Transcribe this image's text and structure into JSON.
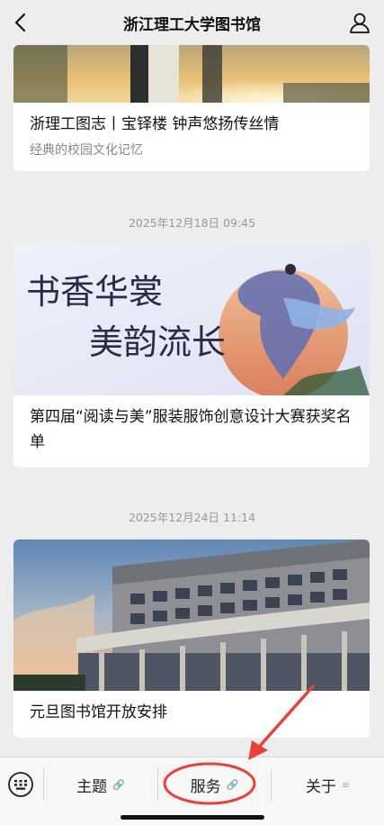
{
  "header": {
    "title": "浙江理工大学图书馆",
    "back_icon": "back-chevron-icon",
    "profile_icon": "user-icon"
  },
  "feed": {
    "card1": {
      "title": "浙理工图志丨宝铎楼 钟声悠扬传丝情",
      "subtitle": "经典的校园文化记忆"
    },
    "timestamp1": "2025年12月18日 09:45",
    "card2": {
      "banner_line1": "书香华裳",
      "banner_line2": "美韵流长",
      "title": "第四届“阅读与美”服装服饰创意设计大赛获奖名单"
    },
    "timestamp2": "2025年12月24日 11:14",
    "card3": {
      "title": "元旦图书馆开放安排"
    }
  },
  "bottom_menu": {
    "keyboard_icon": "keyboard-icon",
    "items": [
      {
        "label": "主题",
        "icon": "link-icon"
      },
      {
        "label": "服务",
        "icon": "link-icon"
      },
      {
        "label": "关于",
        "icon": "list-icon"
      }
    ]
  },
  "colors": {
    "background": "#ededed",
    "annotation_red": "#e8403a",
    "accent_blue": "#5f6fb3"
  }
}
